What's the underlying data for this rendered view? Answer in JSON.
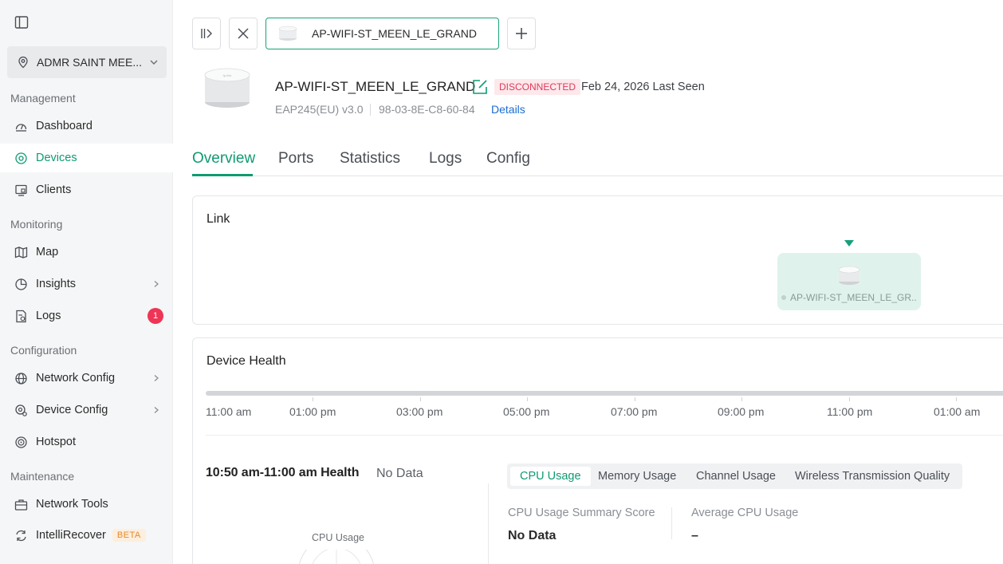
{
  "sidebar": {
    "site_name": "ADMR SAINT MEE...",
    "sections": {
      "management": "Management",
      "monitoring": "Monitoring",
      "configuration": "Configuration",
      "maintenance": "Maintenance"
    },
    "items": {
      "dashboard": "Dashboard",
      "devices": "Devices",
      "clients": "Clients",
      "map": "Map",
      "insights": "Insights",
      "logs": "Logs",
      "logs_badge": "1",
      "network_config": "Network Config",
      "device_config": "Device Config",
      "hotspot": "Hotspot",
      "network_tools": "Network Tools",
      "intellirecover": "IntelliRecover",
      "beta": "BETA"
    }
  },
  "tabbar": {
    "device_tab": "AP-WIFI-ST_MEEN_LE_GRAND"
  },
  "device": {
    "name": "AP-WIFI-ST_MEEN_LE_GRAND",
    "status": "DISCONNECTED",
    "last_seen": "Feb 24, 2026 Last Seen",
    "model": "EAP245(EU) v3.0",
    "mac": "98-03-8E-C8-60-84",
    "details_link": "Details"
  },
  "tabs": [
    "Overview",
    "Ports",
    "Statistics",
    "Logs",
    "Config"
  ],
  "link_card": {
    "title": "Link",
    "node_name": "AP-WIFI-ST_MEEN_LE_GR..."
  },
  "health_card": {
    "title": "Device Health",
    "timeline": [
      "11:00 am",
      "01:00 pm",
      "03:00 pm",
      "05:00 pm",
      "07:00 pm",
      "09:00 pm",
      "11:00 pm",
      "01:00 am"
    ],
    "range_health": "10:50 am-11:00 am Health",
    "range_status": "No Data",
    "gauge_label": "CPU Usage",
    "metric_tabs": [
      "CPU Usage",
      "Memory Usage",
      "Channel Usage",
      "Wireless Transmission Quality"
    ],
    "summary_score_label": "CPU Usage Summary Score",
    "summary_score_value": "No Data",
    "average_label": "Average CPU Usage",
    "average_value": "–"
  },
  "colors": {
    "accent": "#0f9b72",
    "status_disconnected": "#e0395a",
    "link": "#1a6dd0",
    "badge": "#ee3556"
  }
}
